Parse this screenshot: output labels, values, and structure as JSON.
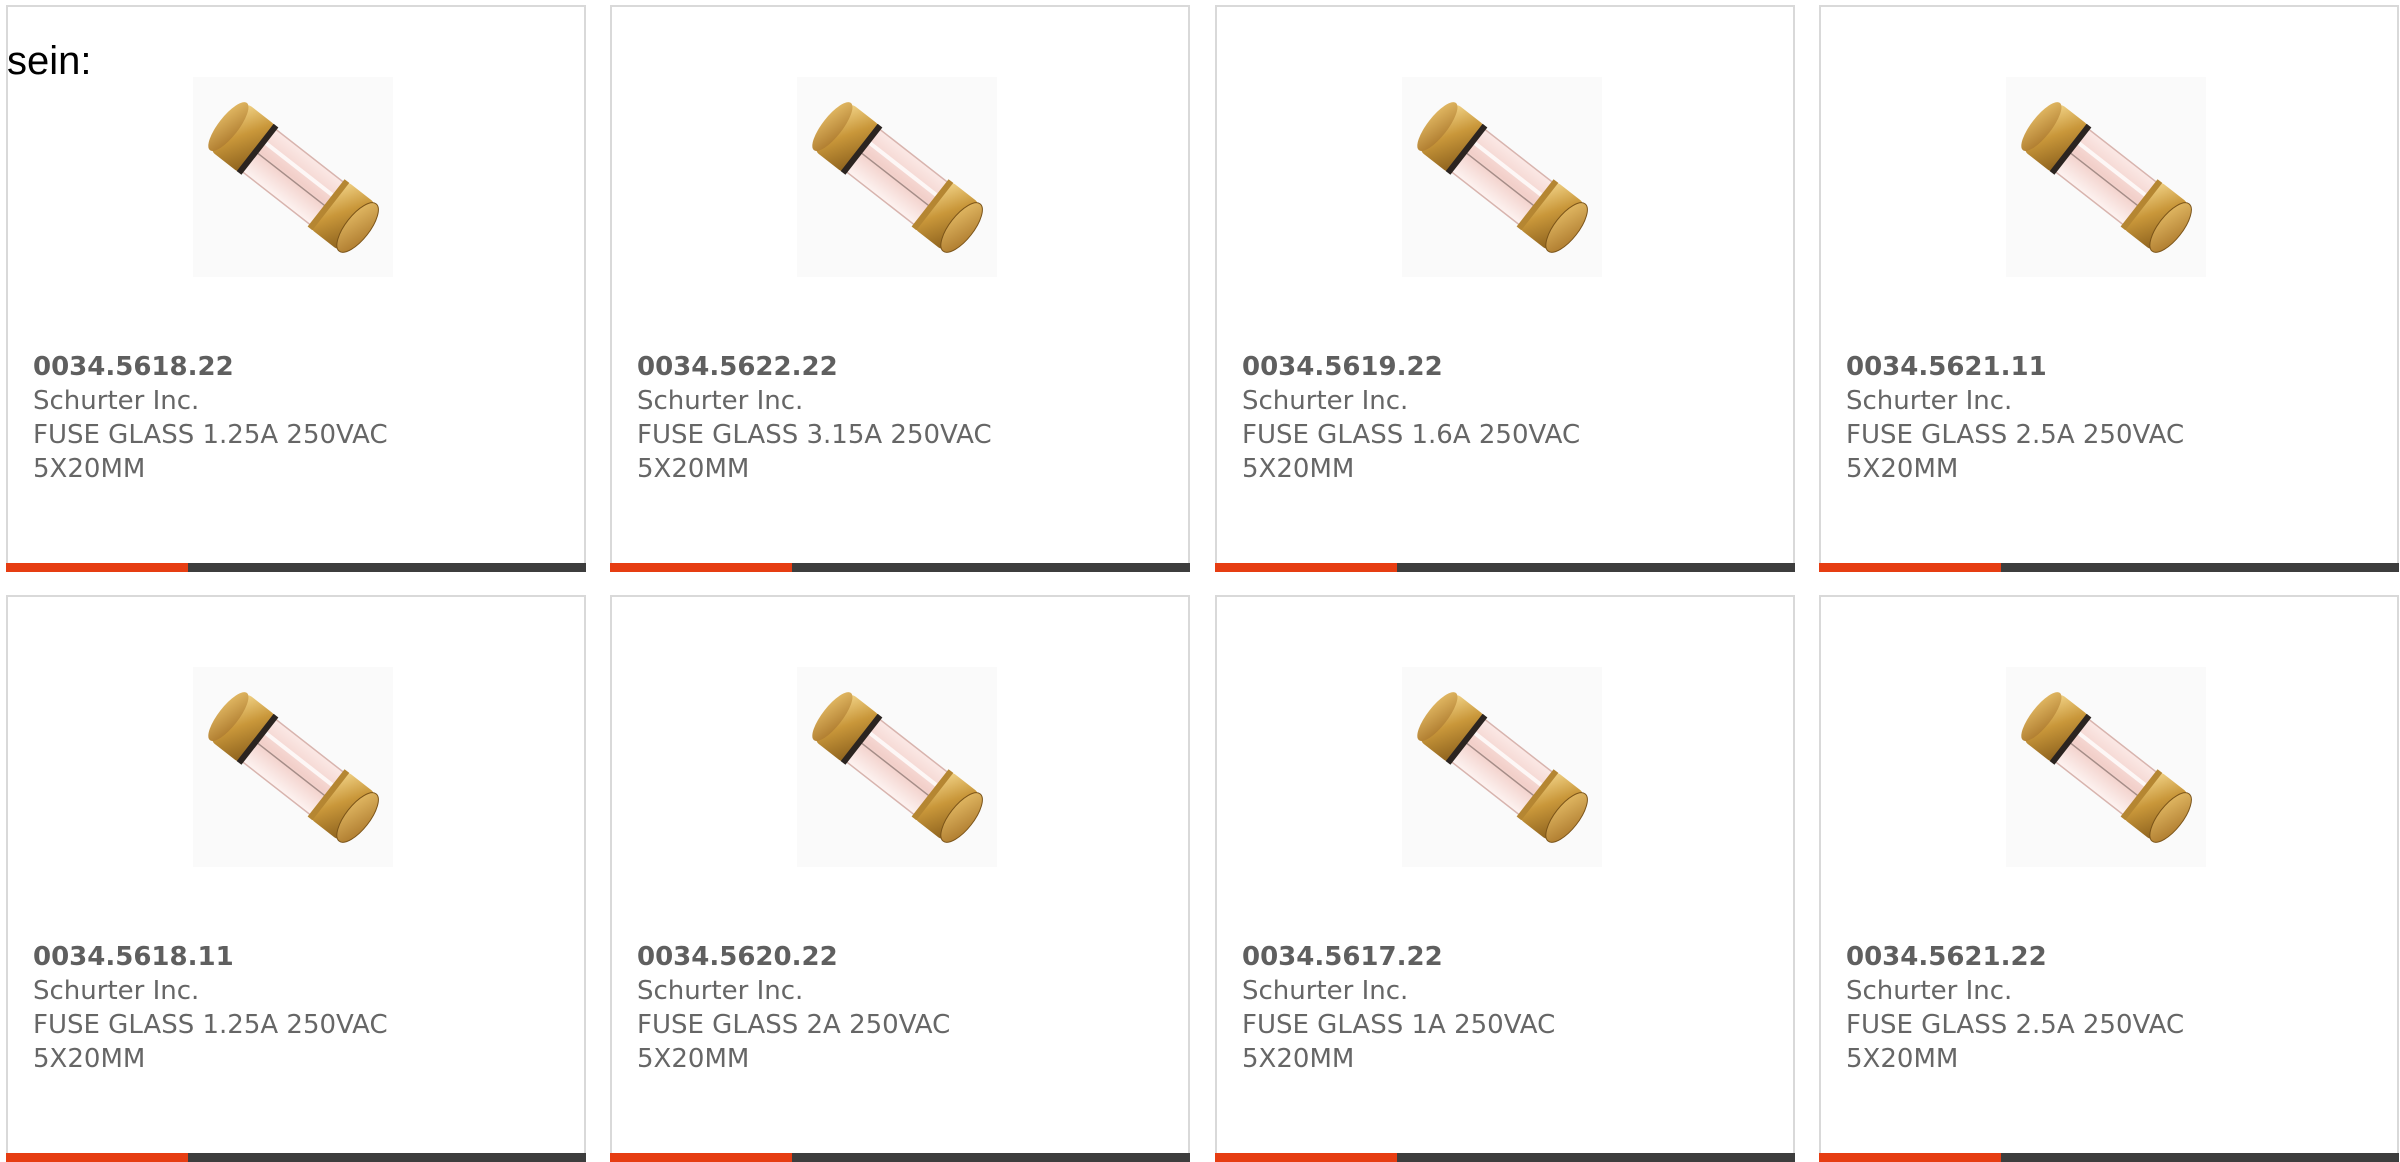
{
  "intro_text": "sein:",
  "colors": {
    "card_border": "#d9d9d9",
    "text": "#666666",
    "bar_dark": "#3d3d3d",
    "bar_accent": "#e63d12"
  },
  "product_image_icon": "glass-fuse-icon",
  "products": [
    {
      "part": "0034.5618.22",
      "maker": "Schurter Inc.",
      "desc": "FUSE GLASS 1.25A 250VAC 5X20MM"
    },
    {
      "part": "0034.5622.22",
      "maker": "Schurter Inc.",
      "desc": "FUSE GLASS 3.15A 250VAC 5X20MM"
    },
    {
      "part": "0034.5619.22",
      "maker": "Schurter Inc.",
      "desc": "FUSE GLASS 1.6A 250VAC 5X20MM"
    },
    {
      "part": "0034.5621.11",
      "maker": "Schurter Inc.",
      "desc": "FUSE GLASS 2.5A 250VAC 5X20MM"
    },
    {
      "part": "0034.5618.11",
      "maker": "Schurter Inc.",
      "desc": "FUSE GLASS 1.25A 250VAC 5X20MM"
    },
    {
      "part": "0034.5620.22",
      "maker": "Schurter Inc.",
      "desc": "FUSE GLASS 2A 250VAC 5X20MM"
    },
    {
      "part": "0034.5617.22",
      "maker": "Schurter Inc.",
      "desc": "FUSE GLASS 1A 250VAC 5X20MM"
    },
    {
      "part": "0034.5621.22",
      "maker": "Schurter Inc.",
      "desc": "FUSE GLASS 2.5A 250VAC 5X20MM"
    }
  ]
}
